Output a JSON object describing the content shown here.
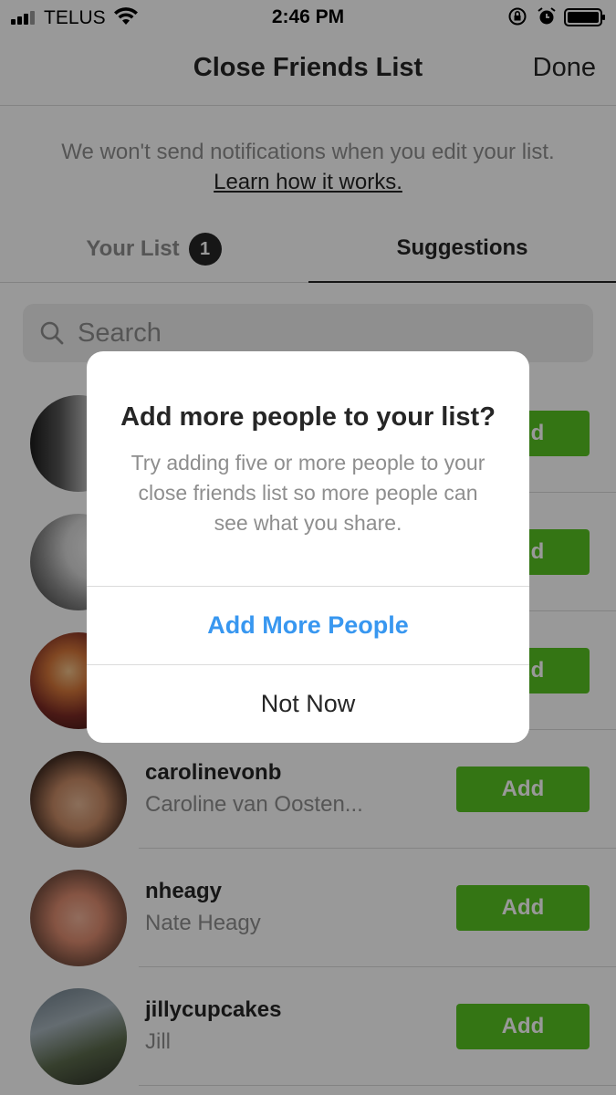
{
  "status_bar": {
    "carrier": "TELUS",
    "time": "2:46 PM"
  },
  "nav": {
    "title": "Close Friends List",
    "done_label": "Done"
  },
  "notice": {
    "text": "We won't send notifications when you edit your list.",
    "link": "Learn how it works."
  },
  "tabs": {
    "your_list_label": "Your List",
    "your_list_count": "1",
    "suggestions_label": "Suggestions",
    "active": "Suggestions"
  },
  "search": {
    "placeholder": "Search"
  },
  "suggestions": [
    {
      "username": "",
      "full_name": "",
      "button": "Add"
    },
    {
      "username": "",
      "full_name": "",
      "button": "Add"
    },
    {
      "username": "",
      "full_name": "",
      "button": "Add"
    },
    {
      "username": "carolinevonb",
      "full_name": "Caroline van Oosten...",
      "button": "Add"
    },
    {
      "username": "nheagy",
      "full_name": "Nate Heagy",
      "button": "Add"
    },
    {
      "username": "jillycupcakes",
      "full_name": "Jill",
      "button": "Add"
    }
  ],
  "dialog": {
    "title": "Add more people to your list?",
    "message": "Try adding five or more people to your close friends list so more people can see what you share.",
    "primary_button": "Add More People",
    "secondary_button": "Not Now"
  },
  "colors": {
    "accent_blue": "#3897f0",
    "add_green": "#58c322",
    "text_dark": "#262626",
    "text_gray": "#8e8e8e"
  }
}
